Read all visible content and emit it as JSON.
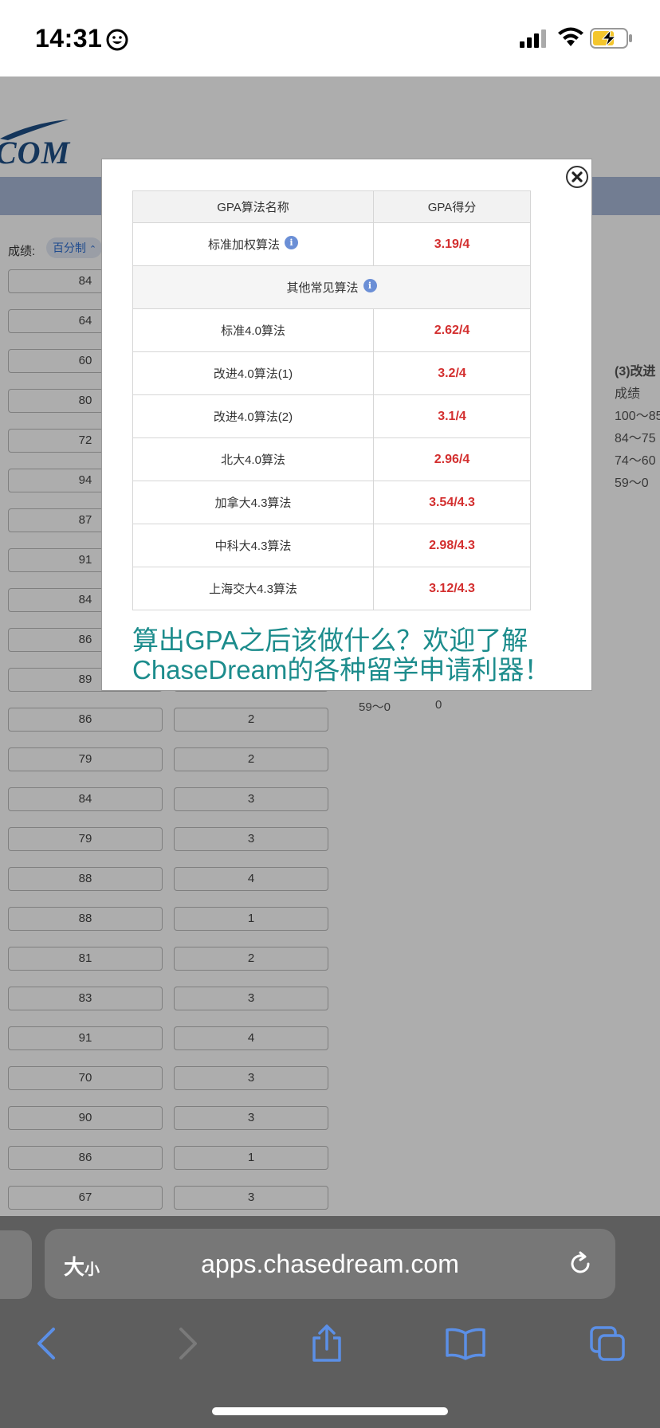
{
  "status_bar": {
    "time": "14:31"
  },
  "background_page": {
    "logo": "COM",
    "grade_label": "成绩:",
    "grade_scale": "百分制",
    "rows": [
      {
        "score": "84",
        "credit": ""
      },
      {
        "score": "64",
        "credit": ""
      },
      {
        "score": "60",
        "credit": ""
      },
      {
        "score": "80",
        "credit": ""
      },
      {
        "score": "72",
        "credit": ""
      },
      {
        "score": "94",
        "credit": ""
      },
      {
        "score": "87",
        "credit": ""
      },
      {
        "score": "91",
        "credit": ""
      },
      {
        "score": "84",
        "credit": ""
      },
      {
        "score": "86",
        "credit": ""
      },
      {
        "score": "89",
        "credit": ""
      },
      {
        "score": "86",
        "credit": "2"
      },
      {
        "score": "79",
        "credit": "2"
      },
      {
        "score": "84",
        "credit": "3"
      },
      {
        "score": "79",
        "credit": "3"
      },
      {
        "score": "88",
        "credit": "4"
      },
      {
        "score": "88",
        "credit": "1"
      },
      {
        "score": "81",
        "credit": "2"
      },
      {
        "score": "83",
        "credit": "3"
      },
      {
        "score": "91",
        "credit": "4"
      },
      {
        "score": "70",
        "credit": "3"
      },
      {
        "score": "90",
        "credit": "3"
      },
      {
        "score": "86",
        "credit": "1"
      },
      {
        "score": "67",
        "credit": "3"
      }
    ],
    "side_panel": {
      "title": "(3)改进",
      "header": "成绩",
      "ranges": [
        "100～85",
        "84～75",
        "74～60",
        "59～0"
      ]
    },
    "score_row": {
      "range": "59～0",
      "points": "0"
    }
  },
  "modal": {
    "table": {
      "header_name": "GPA算法名称",
      "header_score": "GPA得分",
      "primary": {
        "name": "标准加权算法",
        "score": "3.19/4"
      },
      "section_label": "其他常见算法",
      "rows": [
        {
          "name": "标准4.0算法",
          "score": "2.62/4"
        },
        {
          "name": "改进4.0算法(1)",
          "score": "3.2/4"
        },
        {
          "name": "改进4.0算法(2)",
          "score": "3.1/4"
        },
        {
          "name": "北大4.0算法",
          "score": "2.96/4"
        },
        {
          "name": "加拿大4.3算法",
          "score": "3.54/4.3"
        },
        {
          "name": "中科大4.3算法",
          "score": "2.98/4.3"
        },
        {
          "name": "上海交大4.3算法",
          "score": "3.12/4.3"
        }
      ]
    },
    "promo_line1": "算出GPA之后该做什么？欢迎了解",
    "promo_line2": "ChaseDream的各种留学申请利器！"
  },
  "browser": {
    "text_size_big": "大",
    "text_size_small": "小",
    "url": "apps.chasedream.com"
  },
  "colors": {
    "score_red": "#d32f2f",
    "promo_teal": "#1c8c8c",
    "toolbar_blue": "#5b8fe6"
  }
}
